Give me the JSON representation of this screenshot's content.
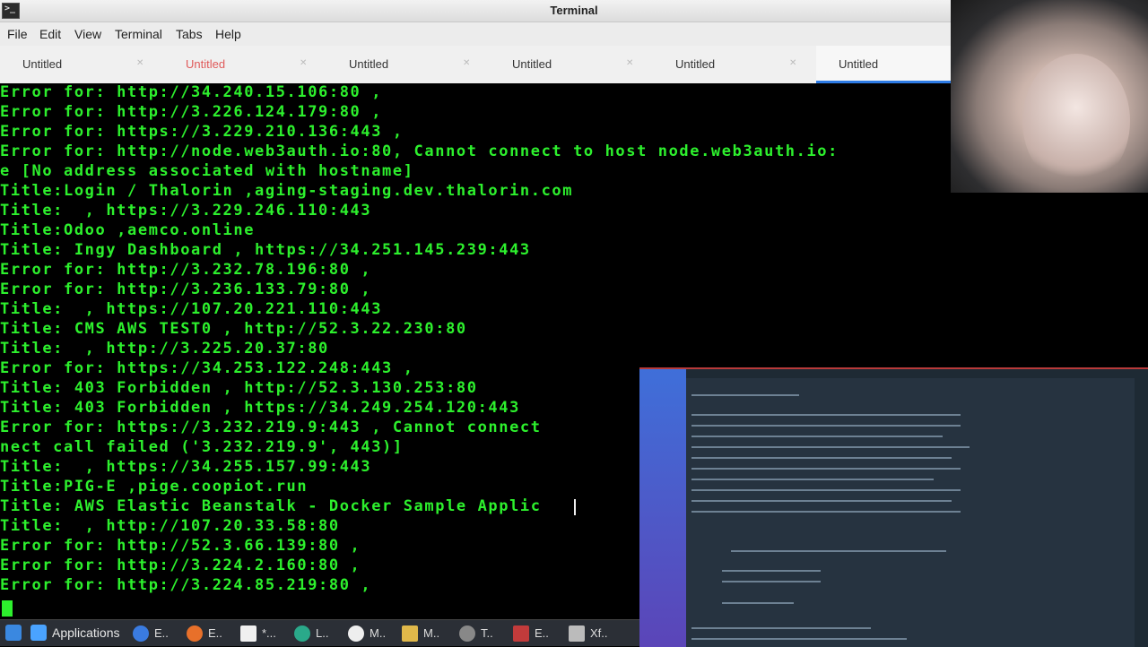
{
  "window": {
    "title": "Terminal"
  },
  "menu": [
    "File",
    "Edit",
    "View",
    "Terminal",
    "Tabs",
    "Help"
  ],
  "tabs": [
    {
      "label": "Untitled",
      "active": false
    },
    {
      "label": "Untitled",
      "active": false,
      "alert": true
    },
    {
      "label": "Untitled",
      "active": false
    },
    {
      "label": "Untitled",
      "active": false
    },
    {
      "label": "Untitled",
      "active": false
    },
    {
      "label": "Untitled",
      "active": true
    }
  ],
  "terminal": {
    "lines": [
      "Error for: http://34.240.15.106:80 ,",
      "Error for: http://3.226.124.179:80 ,",
      "Error for: https://3.229.210.136:443 ,",
      "Error for: http://node.web3auth.io:80, Cannot connect to host node.web3auth.io:",
      "e [No address associated with hostname]",
      "Title:Login / Thalorin ,aging-staging.dev.thalorin.com",
      "Title:  , https://3.229.246.110:443",
      "Title:Odoo ,aemco.online",
      "Title: Ingy Dashboard , https://34.251.145.239:443",
      "Error for: http://3.232.78.196:80 ,",
      "Error for: http://3.236.133.79:80 ,",
      "Title:  , https://107.20.221.110:443",
      "Title: CMS AWS TEST0 , http://52.3.22.230:80",
      "Title:  , http://3.225.20.37:80",
      "Error for: https://34.253.122.248:443 ,",
      "Title: 403 Forbidden , http://52.3.130.253:80",
      "Title: 403 Forbidden , https://34.249.254.120:443",
      "Error for: https://3.232.219.9:443 , Cannot connect",
      "nect call failed ('3.232.219.9', 443)]",
      "Title:  , https://34.255.157.99:443",
      "Title:PIG-E ,pige.coopiot.run",
      "Title: AWS Elastic Beanstalk - Docker Sample Applic",
      "Title:  , http://107.20.33.58:80",
      "Error for: http://52.3.66.139:80 ,",
      "Error for: http://3.224.2.160:80 ,",
      "Error for: http://3.224.85.219:80 ,"
    ],
    "text_color": "#2df02d",
    "background": "#000000"
  },
  "taskbar": {
    "applications_label": "Applications",
    "items": [
      {
        "icon": "browser-icon",
        "label": "E..",
        "color": "#3a7be0"
      },
      {
        "icon": "firefox-icon",
        "label": "E..",
        "color": "#e8702a"
      },
      {
        "icon": "text-editor-icon",
        "label": "*...",
        "color": "#f0f0f0"
      },
      {
        "icon": "terminal-icon",
        "label": "L..",
        "color": "#2aa98a"
      },
      {
        "icon": "media-icon",
        "label": "M..",
        "color": "#eeeeee"
      },
      {
        "icon": "files-icon",
        "label": "M..",
        "color": "#e0b84a"
      },
      {
        "icon": "tools-icon",
        "label": "T..",
        "color": "#888888"
      },
      {
        "icon": "app-icon",
        "label": "E..",
        "color": "#c23b3b"
      },
      {
        "icon": "window-icon",
        "label": "Xf..",
        "color": "#bbbbbb"
      }
    ]
  }
}
